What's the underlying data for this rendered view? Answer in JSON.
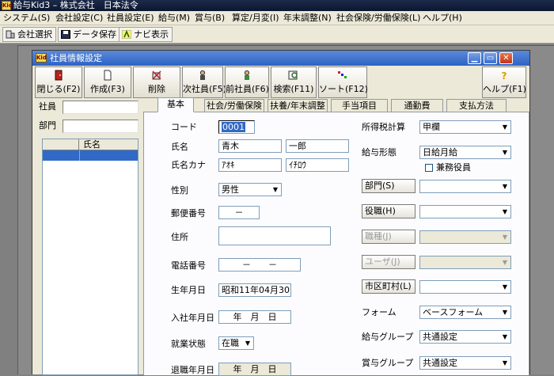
{
  "app": {
    "title": "給与Kid3 – 株式会社　日本法令",
    "icon_text": "Kid"
  },
  "menu": [
    "システム(S)",
    "会社設定(C)",
    "社員設定(E)",
    "給与(M)",
    "賞与(B)",
    "算定/月変(I)",
    "年末調整(N)",
    "社会保険/労働保険(L)",
    "ヘルプ(H)"
  ],
  "toolbar": {
    "company_select": "会社選択",
    "data_save": "データ保存",
    "navi_show": "ナビ表示"
  },
  "window": {
    "title": "社員情報設定",
    "icon_text": "Kid"
  },
  "buttons": {
    "close": "閉じる(F2)",
    "create": "作成(F3)",
    "delete": "削除",
    "next": "次社員(F5)",
    "prev": "前社員(F6)",
    "search": "検索(F11)",
    "sort": "ソート(F12)",
    "help": "ヘルプ(F1)"
  },
  "left_panel": {
    "employee_label": "社員",
    "employee_value": "",
    "dept_label": "部門",
    "dept_value": "",
    "list_header_name": "氏名"
  },
  "tabs": [
    "基本",
    "社会/労働保険",
    "扶養/年末調整",
    "手当項目",
    "通勤費",
    "支払方法"
  ],
  "form": {
    "code_label": "コード",
    "code_value": "0001",
    "name_label": "氏名",
    "last_name": "青木",
    "first_name": "一郎",
    "kana_label": "氏名カナ",
    "last_kana": "ｱｵｷ",
    "first_kana": "ｲﾁﾛｳ",
    "gender_label": "性別",
    "gender_value": "男性",
    "postal_label": "郵便番号",
    "postal_value": "－",
    "address_label": "住所",
    "address_value": "",
    "phone_label": "電話番号",
    "phone_value": "－　　－",
    "birth_label": "生年月日",
    "birth_value": "昭和11年04月30日",
    "hire_label": "入社年月日",
    "hire_value": "年　月　日",
    "status_label": "就業状態",
    "status_value": "在職",
    "retire_label": "退職年月日",
    "retire_value": "年　月　日"
  },
  "right_form": {
    "tax_label": "所得税計算",
    "tax_value": "甲欄",
    "pay_form_label": "給与形態",
    "pay_form_value": "日給月給",
    "officer_label": "兼務役員",
    "dept_btn": "部門(S)",
    "dept_value": "",
    "position_btn": "役職(H)",
    "position_value": "",
    "job_btn": "職種(J)",
    "job_value": "",
    "user_btn": "ユーザ(J)",
    "user_value": "",
    "city_btn": "市区町村(L)",
    "city_value": "",
    "form_label": "フォーム",
    "form_value": "ベースフォーム",
    "salary_group_label": "給与グループ",
    "salary_group_value": "共通設定",
    "bonus_group_label": "賞与グループ",
    "bonus_group_value": "共通設定"
  }
}
